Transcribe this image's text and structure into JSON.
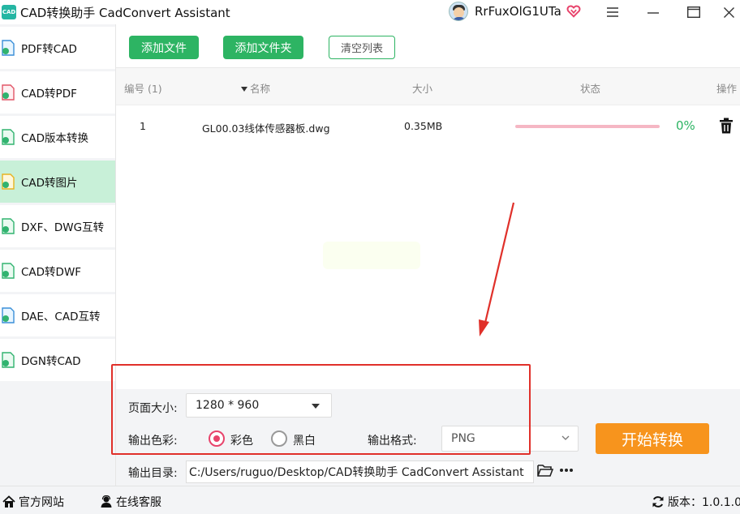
{
  "titlebar": {
    "app_logo_text": "CAD",
    "title": "CAD转换助手 CadConvert Assistant",
    "username": "RrFuxOlG1UTa",
    "icons": [
      "avatar",
      "vip-heart-icon",
      "menu-icon",
      "minimize-icon",
      "maximize-icon",
      "close-icon"
    ]
  },
  "sidebar": {
    "items": [
      {
        "label": "PDF转CAD",
        "icon": "pdf-to-cad-icon",
        "active": false
      },
      {
        "label": "CAD转PDF",
        "icon": "cad-to-pdf-icon",
        "active": false
      },
      {
        "label": "CAD版本转换",
        "icon": "cad-version-icon",
        "active": false
      },
      {
        "label": "CAD转图片",
        "icon": "cad-to-image-icon",
        "active": true
      },
      {
        "label": "DXF、DWG互转",
        "icon": "dxf-dwg-icon",
        "active": false
      },
      {
        "label": "CAD转DWF",
        "icon": "cad-to-dwf-icon",
        "active": false
      },
      {
        "label": "DAE、CAD互转",
        "icon": "dae-cad-icon",
        "active": false
      },
      {
        "label": "DGN转CAD",
        "icon": "dgn-to-cad-icon",
        "active": false
      }
    ]
  },
  "toolbar": {
    "add_file": "添加文件",
    "add_folder": "添加文件夹",
    "clear_list": "清空列表"
  },
  "table": {
    "headers": {
      "index": "编号 (1)",
      "name": "名称",
      "size": "大小",
      "status": "状态",
      "action": "操作"
    },
    "rows": [
      {
        "index": "1",
        "name": "GL00.03线体传感器板.dwg",
        "size": "0.35MB",
        "progress": 0,
        "percent": "0%"
      }
    ]
  },
  "settings": {
    "page_size_label": "页面大小:",
    "page_size_value": "1280 * 960",
    "color_label": "输出色彩:",
    "color_options": [
      "彩色",
      "黑白"
    ],
    "color_selected": "彩色",
    "format_label": "输出格式:",
    "format_value": "PNG",
    "output_dir_label": "输出目录:",
    "output_dir_value": "C:/Users/ruguo/Desktop/CAD转换助手 CadConvert Assistant",
    "start_button": "开始转换"
  },
  "statusbar": {
    "website": "官方网站",
    "support": "在线客服",
    "version": "版本：1.0.1.0"
  },
  "colors": {
    "accent_green": "#2db463",
    "start_orange": "#f7941d",
    "active_sidebar": "#c8f0d8",
    "radio_pink": "#e8436b",
    "annotation_red": "#e0302a"
  }
}
